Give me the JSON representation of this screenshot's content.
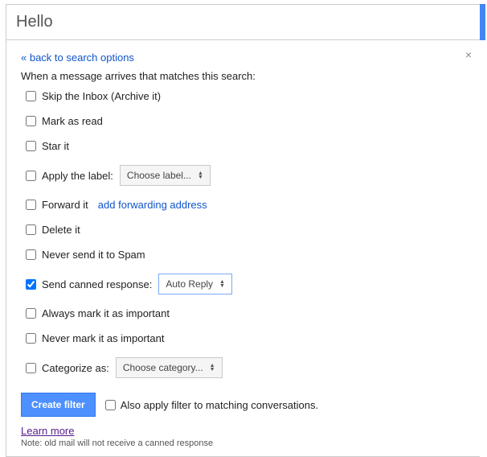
{
  "search": {
    "value": "Hello"
  },
  "panel": {
    "back_link": "« back to search options",
    "close_glyph": "×",
    "intro": "When a message arrives that matches this search:",
    "options": {
      "skip_inbox": {
        "label": "Skip the Inbox (Archive it)",
        "checked": false
      },
      "mark_read": {
        "label": "Mark as read",
        "checked": false
      },
      "star_it": {
        "label": "Star it",
        "checked": false
      },
      "apply_label": {
        "label": "Apply the label:",
        "checked": false,
        "select_text": "Choose label..."
      },
      "forward_it": {
        "label": "Forward it",
        "checked": false,
        "link_text": "add forwarding address"
      },
      "delete_it": {
        "label": "Delete it",
        "checked": false
      },
      "never_spam": {
        "label": "Never send it to Spam",
        "checked": false
      },
      "send_canned": {
        "label": "Send canned response:",
        "checked": true,
        "select_text": "Auto Reply"
      },
      "always_important": {
        "label": "Always mark it as important",
        "checked": false
      },
      "never_important": {
        "label": "Never mark it as important",
        "checked": false
      },
      "categorize": {
        "label": "Categorize as:",
        "checked": false,
        "select_text": "Choose category..."
      }
    },
    "create_button": "Create filter",
    "also_apply": {
      "label": "Also apply filter to matching conversations.",
      "checked": false
    },
    "learn_more": "Learn more",
    "note": "Note: old mail will not receive a canned response"
  }
}
